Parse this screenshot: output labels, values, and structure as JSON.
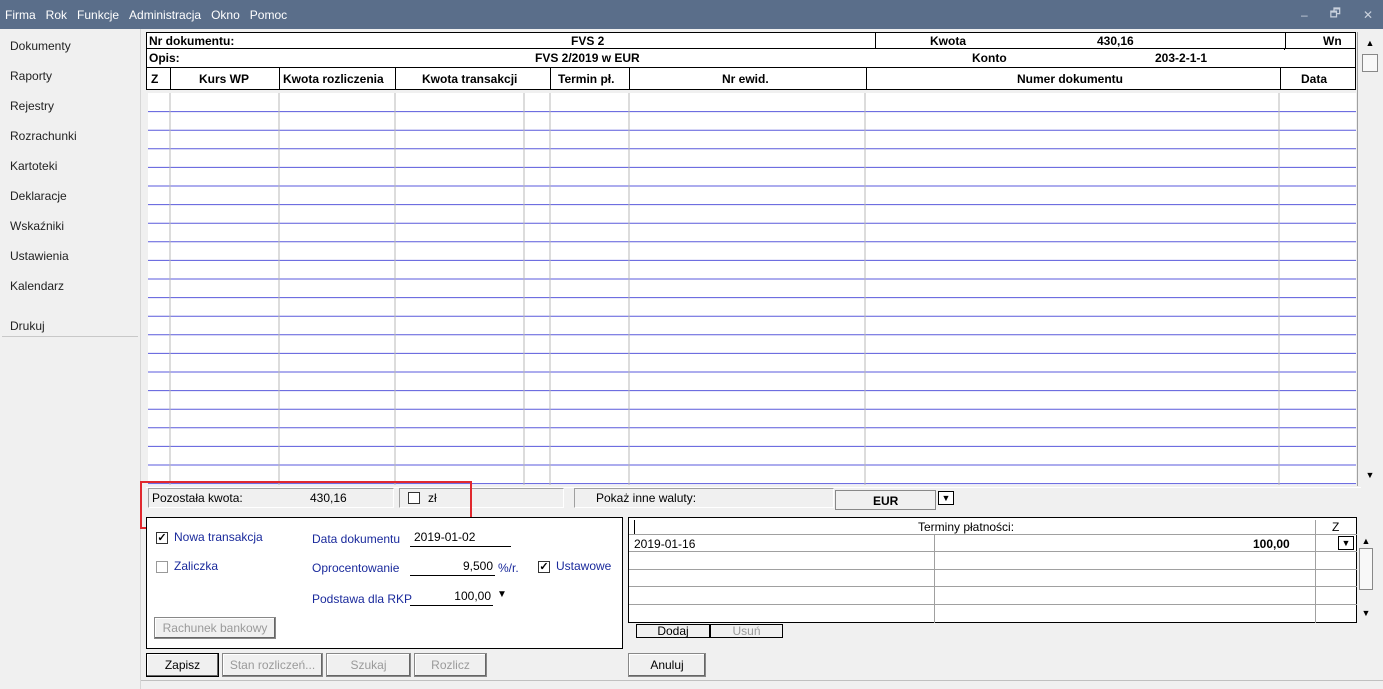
{
  "menu": [
    "Firma",
    "Rok",
    "Funkcje",
    "Administracja",
    "Okno",
    "Pomoc"
  ],
  "window_controls": {
    "minimize": "–",
    "restore": "🗗",
    "close": "✕"
  },
  "sidebar": {
    "items": [
      "Dokumenty",
      "Raporty",
      "Rejestry",
      "Rozrachunki",
      "Kartoteki",
      "Deklaracje",
      "Wskaźniki",
      "Ustawienia",
      "Kalendarz"
    ],
    "print": "Drukuj"
  },
  "doc_header": {
    "nr_label": "Nr dokumentu:",
    "nr_value": "FVS 2",
    "kwota_label": "Kwota",
    "kwota_value": "430,16",
    "side": "Wn",
    "opis_label": "Opis:",
    "opis_value": "FVS  2/2019 w EUR",
    "konto_label": "Konto",
    "konto_value": "203-2-1-1"
  },
  "table": {
    "columns": [
      "Z",
      "Kurs WP",
      "Kwota rozliczenia",
      "Kwota transakcji",
      "Termin pł.",
      "Nr ewid.",
      "Numer dokumentu",
      "Data"
    ]
  },
  "summary": {
    "remaining_label": "Pozostała kwota:",
    "remaining_value": "430,16",
    "currency_checkbox_label": "zł",
    "other_currencies_label": "Pokaż inne waluty:",
    "currency": "EUR"
  },
  "form": {
    "new_transaction": "Nowa transakcja",
    "advance": "Zaliczka",
    "doc_date_label": "Data dokumentu",
    "doc_date": "2019-01-02",
    "interest_label": "Oprocentowanie",
    "interest_value": "9,500",
    "interest_unit": "%/r.",
    "statutory": "Ustawowe",
    "rkp_label": "Podstawa dla RKP",
    "rkp_value": "100,00",
    "bank_button": "Rachunek bankowy"
  },
  "terms": {
    "title": "Terminy płatności:",
    "z_header": "Z",
    "rows": [
      {
        "date": "2019-01-16",
        "amount": "100,00"
      }
    ],
    "add_button": "Dodaj",
    "remove_button": "Usuń"
  },
  "actions": {
    "save": "Zapisz",
    "status": "Stan rozliczeń...",
    "search": "Szukaj",
    "settle": "Rozlicz",
    "cancel": "Anuluj"
  },
  "colors": {
    "menubar": "#5a6e8a",
    "highlight_box": "#e0282e",
    "link_blue": "#1a2a9c"
  }
}
